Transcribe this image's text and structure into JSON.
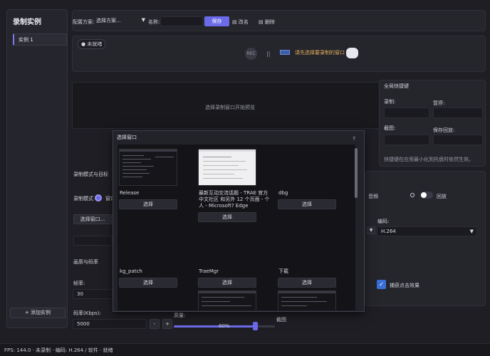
{
  "sidebar": {
    "title": "录制实例",
    "item": "实例 1",
    "add_label": "+ 添加实例"
  },
  "config": {
    "scheme_label": "配置方案:",
    "scheme_value": "选择方案...",
    "name_label": "名称:",
    "save_label": "保存",
    "rename_label": "改名",
    "delete_label": "删除"
  },
  "status": {
    "pill": "● 未就绪",
    "rec_label": "REC",
    "pause_label": "||",
    "prompt": "请先选择要录制的窗口"
  },
  "preview": {
    "placeholder": "选择录制窗口开始预览"
  },
  "hotkeys": {
    "title": "全局快捷键",
    "record_label": "录制:",
    "pause_label": "暂停:",
    "screenshot_label": "截图:",
    "save_replay_label": "保存回放:",
    "note": "快捷键在应用最小化到托盘时依然生效。"
  },
  "mode": {
    "section_title": "录制模式与目标",
    "mode_label": "录制模式",
    "mode_option": "窗口",
    "select_window_btn": "选择窗口..."
  },
  "quality": {
    "section_title": "画质与码率",
    "fps_label": "帧率:",
    "fps_value": "30",
    "bitrate_label": "码率(Kbps):",
    "bitrate_value": "5000",
    "minus": "-",
    "plus": "+",
    "quality_label": "质量:",
    "quality_value": "80%",
    "quality_fraction": 0.8,
    "screenshot_label": "截图"
  },
  "audio": {
    "audio_label": "音频",
    "playback_label": "回放",
    "encoder_label": "编码:",
    "encoder_value": "H.264",
    "capture_clicks_label": "捕获点击效果"
  },
  "dialog": {
    "title": "选择窗口",
    "help": "?",
    "choose_label": "选择",
    "windows": [
      {
        "name": "Release"
      },
      {
        "name": "最新互动交流话题 - TRAE 官方中文社区 和另外 12 个页面 - 个人 - Microsoft? Edge"
      },
      {
        "name": "dbg"
      },
      {
        "name": "kg_patch"
      },
      {
        "name": "TraeMgr"
      },
      {
        "name": "下载"
      }
    ]
  },
  "statusbar": {
    "fps_label": "FPS:",
    "fps_value": "144.0",
    "rec_state": "未录制",
    "encoder": "编码: H.264 / 软件",
    "ready": "就绪",
    "sep": "·"
  },
  "colors": {
    "accent": "#6b6bea",
    "warning": "#e3b05a",
    "check": "#3b6fd8"
  }
}
